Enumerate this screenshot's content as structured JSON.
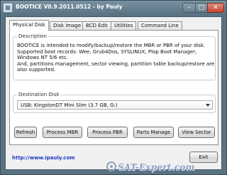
{
  "window": {
    "title": "BOOTICE V0.9.2011.0512 - by Pauly",
    "minimize_glyph": "–",
    "maximize_glyph": "□",
    "close_glyph": "✕",
    "app_icon": "app-icon"
  },
  "tabs": [
    {
      "label": "Physical Disk",
      "active": true
    },
    {
      "label": "Disk Image",
      "active": false
    },
    {
      "label": "BCD Edit",
      "active": false
    },
    {
      "label": "Utilities",
      "active": false
    },
    {
      "label": "Command Line",
      "active": false
    }
  ],
  "description": {
    "label": "Description",
    "lines": [
      "BOOTICE is intended to modify/backup/restore the MBR or PBR of your disk.",
      "Supported boot records: Wee, Grub4Dos, SYSLINUX, Plop Boot Manager,",
      "Windows NT 5/6 etc.",
      "And, partitions management, sector viewing, partition table backup/restore are",
      "also supported."
    ]
  },
  "destination": {
    "label": "Destination Disk",
    "selected": "USB: KingstonDT Mini Slim (3.7 GB, G:)"
  },
  "actions": [
    {
      "label": "Refresh"
    },
    {
      "label": "Process MBR"
    },
    {
      "label": "Process PBR"
    },
    {
      "label": "Parts Manage"
    },
    {
      "label": "View Sector"
    }
  ],
  "footer": {
    "link": "http://www.ipauly.com",
    "exit_label": "Exit"
  },
  "watermark": {
    "text": "SAT-Expert.com"
  }
}
